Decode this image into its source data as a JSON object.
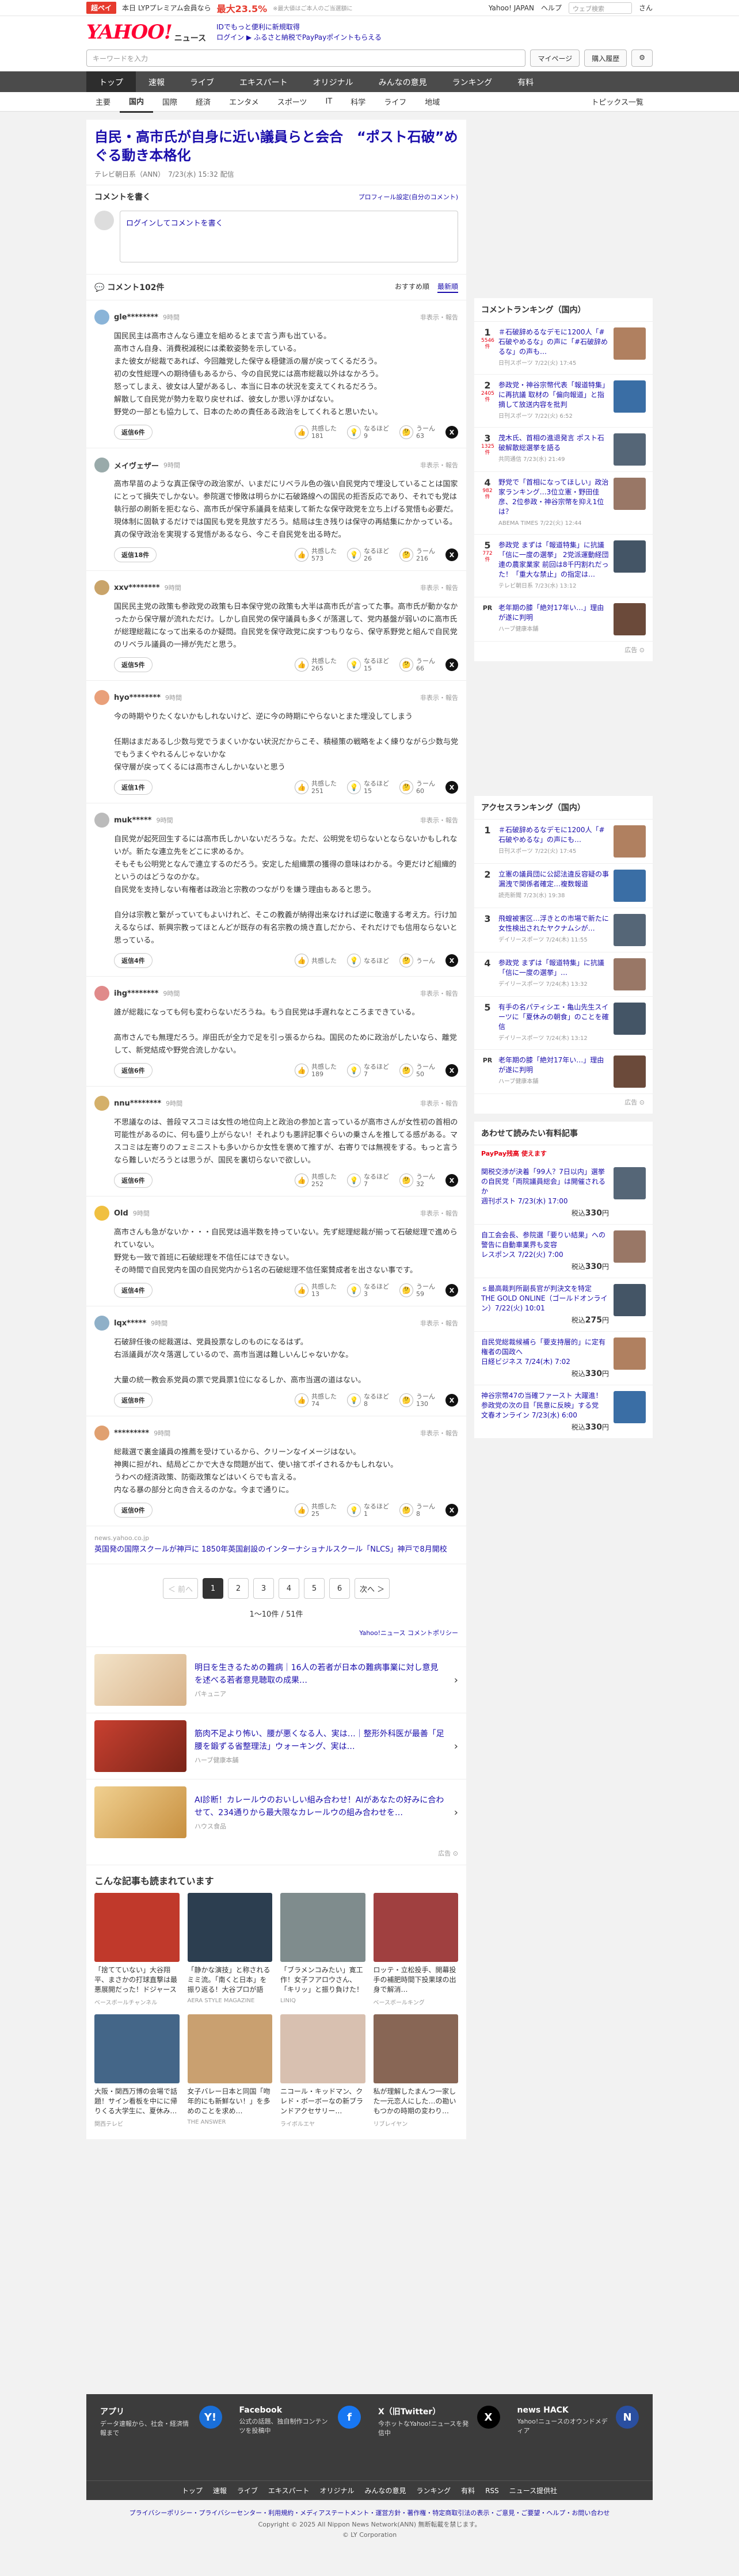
{
  "topbar": {
    "ad_label": "超ペイ",
    "ad_text": "本日 LYPプレミアム会員なら",
    "ad_pct": "最大23.5%",
    "ad_note": "※最大値はご本人のご当選額に",
    "links": [
      "Yahoo! JAPAN",
      "ヘルプ"
    ],
    "search_placeholder": "ウェブ検索",
    "user": "さん"
  },
  "header": {
    "logo": "YAHOO!",
    "logo_sub": "ニュース",
    "msg1": "IDでもっと便利に新規取得",
    "msg2": "ログイン ▶ ふるさと納税でPayPayポイントもらえる"
  },
  "search": {
    "placeholder": "キーワードを入力",
    "btn_mypage": "マイページ",
    "btn_subscribe": "購入履歴"
  },
  "mainnav": [
    "トップ",
    "速報",
    "ライブ",
    "エキスパート",
    "オリジナル",
    "みんなの意見",
    "ランキング",
    "有料"
  ],
  "subnav": [
    "主要",
    "国内",
    "国際",
    "経済",
    "エンタメ",
    "スポーツ",
    "IT",
    "科学",
    "ライフ",
    "地域"
  ],
  "subnav_right": "トピックス一覧",
  "article": {
    "title": "自民・高市氏が自身に近い議員らと会合　“ポスト石破”めぐる動き本格化",
    "meta": "テレビ朝日系（ANN）　7/23(水) 15:32 配信"
  },
  "comment_form": {
    "heading": "コメントを書く",
    "profile_link": "プロフィール設定(自分のコメント)",
    "login_prompt": "ログインしてコメントを書く"
  },
  "comments_header": {
    "count": "コメント102件",
    "sort_recommended": "おすすめ順",
    "sort_newest": "最新順"
  },
  "labels": {
    "nonrep": "非表示・報告",
    "react1": "共感した",
    "react2": "なるほど",
    "react3": "うーん",
    "x": "X"
  },
  "comments": [
    {
      "user": "gle********",
      "ago": "9時間",
      "color": "#8ab4d8",
      "body": "国民民主は高市さんなら連立を組めるとまで言う声も出ている。\n高市さん自身、消費税減税には柔軟姿勢を示している。\nまた彼女が総裁であれば、今回離党した保守＆穏健派の層が戻ってくるだろう。\n初の女性総理への期待値もあるから、今の自民党には高市総裁以外はなかろう。\n怒ってしまえ、彼女は人望があるし、本当に日本の状況を変えてくれるだろう。\n解散して自民党が勢力を取り戻せれば、彼女しか思い浮かばない。\n野党の一部とも協力して、日本のための責任ある政治をしてくれると思いたい。",
      "reply": "返信6件",
      "r1": "181",
      "r2": "9",
      "r3": "63"
    },
    {
      "user": "メイヴェザー",
      "ago": "9時間",
      "color": "#9aa",
      "body": "高市早苗のような真正保守の政治家が、いまだにリベラル色の強い自民党内で埋没していることは国家にとって損失でしかない。参院選で惨敗は明らかに石破路線への国民の拒否反応であり、それでも党は執行部の刷新を拒むなら、高市氏が保守系議員を結束して新たな保守政党を立ち上げる覚悟も必要だ。現体制に固執するだけでは国民も党を見放すだろう。結局は生き残りは保守の再結集にかかっている。真の保守政治を実現する覚悟があるなら、今こそ自民党を出る時だ。",
      "reply": "返信18件",
      "r1": "573",
      "r2": "26",
      "r3": "216"
    },
    {
      "user": "xxv********",
      "ago": "9時間",
      "color": "#c9a46a",
      "body": "国民民主党の政策も参政党の政策も日本保守党の政策も大半は高市氏が言ってた事。高市氏が動かなかったから保守層が流れただけ。しかし自民党の保守議員も多くが落選して、党内基盤が弱いのに高市氏が総理総裁になって出来るのか疑問。自民党を保守政党に戻すつもりなら、保守系野党と組んで自民党のリベラル議員の一掃が先だと思う。",
      "reply": "返信5件",
      "r1": "265",
      "r2": "15",
      "r3": "66"
    },
    {
      "user": "hyo********",
      "ago": "9時間",
      "color": "#e9a07a",
      "body": "今の時期やりたくないかもしれないけど、逆に今の時期にやらないとまた埋没してしまう\n\n任期はまだあるし少数与党でうまくいかない状況だからこそ、積極策の戦略をよく練りながら少数与党でもうまくやれるんじゃないかな\n保守層が戻ってくるには高市さんしかいないと思う",
      "reply": "返信1件",
      "r1": "251",
      "r2": "15",
      "r3": "60"
    },
    {
      "user": "muk*****",
      "ago": "9時間",
      "color": "#bbb",
      "body": "自民党が起死回生するには高市氏しかいないだろうな。ただ、公明党を切らないとならないかもしれないが。新たな連立先をどこに求めるか。\nそもそも公明党となんで連立するのだろう。安定した組織票の獲得の意味はわかる。今更だけど組織的というのはどうなのかな。\n自民党を支持しない有権者は政治と宗教のつながりを嫌う理由もあると思う。\n\n自分は宗教と繋がっていてもよいけれど、そこの教義が納得出来なければ逆に敬遠する考え方。行け加えるならば、新興宗教ってほとんどが既存の有名宗教の焼き直しだから、それだけでも信用ならないと思っている。",
      "reply": "返信4件",
      "r1": "",
      "r2": "",
      "r3": ""
    },
    {
      "user": "ihg********",
      "ago": "9時間",
      "color": "#e08a8a",
      "body": "誰が総裁になっても何も変わらないだろうね。もう自民党は手遅れなところまできている。\n\n高市さんでも無理だろう。岸田氏が全力で足を引っ張るからね。国民のために政治がしたいなら、離党して、新党結成や野党合流しかない。",
      "reply": "返信6件",
      "r1": "189",
      "r2": "7",
      "r3": "50"
    },
    {
      "user": "nnu********",
      "ago": "9時間",
      "color": "#d4b06a",
      "body": "不思議なのは、普段マスコミは女性の地位向上と政治の参加と言っているが高市さんが女性初の首相の可能性があるのに、何も盛り上がらない！それよりも悪評記事ぐらいの乗さんを推してる感がある。マスコミは左寄りのフェミニストも多いからか女性を褒めて推すが、右寄りでは無視をする。もっと言うなら難しいだろうとは思うが、国民を裏切らないで欲しい。",
      "reply": "返信6件",
      "r1": "252",
      "r2": "7",
      "r3": "32"
    },
    {
      "user": "Old",
      "ago": "9時間",
      "color": "#f0c040",
      "body": "高市さんも急がないか・・・自民党は過半数を持っていない。先ず総理総裁が揃って石破総理で進められていない。\n野党も一致で首班に石破総理を不信任にはできない。\nその時間で自民党内を国の自民党内から1名の石破総理不信任案賛成者を出さない事です。",
      "reply": "返信4件",
      "r1": "13",
      "r2": "3",
      "r3": "59"
    },
    {
      "user": "lqx*****",
      "ago": "9時間",
      "color": "#8fb0c8",
      "body": "石破辞任後の総裁選は、党員投票なしのものになるはず。\n右派議員が次々落選しているので、高市当選は難しいんじゃないかな。\n\n大量の統一教会系党員の票で党員票1位になるしか、高市当選の道はない。",
      "reply": "返信8件",
      "r1": "74",
      "r2": "8",
      "r3": "130"
    },
    {
      "user": "*********",
      "ago": "9時間",
      "color": "#e0a070",
      "body": "総裁選で裏金議員の推薦を受けているから、クリーンなイメージはない。\n神輿に担がれ、結局どこかで大きな問題が出て、使い捨てポイされるかもしれない。\nうわべの経済政策、防衛政策などはいくらでも言える。\n内なる暴の部分と向き合えるのかな。今まで通りに。",
      "reply": "返信0件",
      "r1": "25",
      "r2": "1",
      "r3": "8"
    }
  ],
  "ad_inline": {
    "source": "news.yahoo.co.jp",
    "title": "英国発の国際スクールが神戸に 1850年英国創設のインターナショナルスクール「NLCS」神戸で8月開校"
  },
  "pager": {
    "prev": "＜ 前へ",
    "pages": [
      "1",
      "2",
      "3",
      "4",
      "5",
      "6"
    ],
    "next": "次へ ＞",
    "info": "1〜10件 / 51件",
    "policy": "Yahoo!ニュース コメントポリシー"
  },
  "promos": [
    {
      "title": "明日を生きるための難病｜16人の若者が日本の難病事業に対し意見を述べる若者意見聴取の成果…",
      "source": "パキュニア"
    },
    {
      "title": "筋肉不足より怖い、腰が悪くなる人、実は…｜整形外科医が最善「足腰を鍛ずる省整理法」ウォーキング、実は…",
      "source": "ハーブ健康本舗"
    },
    {
      "title": "AI診断！カレールウのおいしい組み合わせ！AIがあなたの好みに合わせて、234通りから最大限なカレールウの組み合わせを…",
      "source": "ハウス食品"
    }
  ],
  "ad_note": "広告 ⊙",
  "related": {
    "heading": "こんな記事も読まれています",
    "items": [
      {
        "title": "「捨てていない」大谷翔平、まさかの打球直撃は最悪展開だった！ドジャースが選んだ…",
        "source": "ベースボールチャンネル"
      },
      {
        "title": "「静かな演技」と称されるミミ流。「南くと日本」を振り返る！大谷プロが語る…",
        "source": "AERA STYLE MAGAZINE"
      },
      {
        "title": "「ブラメンコみたい」寛工作！女子フアロウさん、「キリッ」と振り負けた！",
        "source": "LINIQ"
      },
      {
        "title": "ロッテ・立松投手、開幕投手の補肥時間下投果球の出身で解消…",
        "source": "ベースボールキング"
      },
      {
        "title": "大阪・関西万博の会場で話題！サイン看板を中にに帰りくる大学生に、夏休み…",
        "source": "関西テレビ"
      },
      {
        "title": "女子バレー日本と同国「吻年的にも新鮮ない！」を多めのことを求め…",
        "source": "THE ANSWER"
      },
      {
        "title": "ニコール・キッドマン、クレド・ボーボーなの新ブランドアクセサリー…",
        "source": "ライボルエヤ"
      },
      {
        "title": "私が理解したまんつ一家した一元恋人にした…の勘いもつかの時期の変わり…",
        "source": "リブレイヤン"
      }
    ]
  },
  "ranking_comment": {
    "heading": "コメントランキング（国内）",
    "items": [
      {
        "num": "1",
        "cnt": "5546件",
        "title": "＃石破辞めるなデモに1200人「#石破やめるな」の声に「#石破辞めるな」の声も…",
        "source": "日刊スポーツ 7/22(火) 17:45"
      },
      {
        "num": "2",
        "cnt": "2405件",
        "title": "参政党・神谷宗幣代表「報道特集」に再抗議 取材の「偏向報道」と指摘して放送内容を批判",
        "source": "日刊スポーツ 7/22(火) 6:52"
      },
      {
        "num": "3",
        "cnt": "1325件",
        "title": "茂木氏、首相の進退発言 ポスト石破解散総選挙を語る",
        "source": "共同通信 7/23(水) 21:49"
      },
      {
        "num": "4",
        "cnt": "982件",
        "title": "野党で「首相になってほしい」政治家ランキング…3位立憲・野田佳彦、2位参政・神谷宗幣を抑え1位は？",
        "source": "ABEMA TIMES 7/22(火) 12:44"
      },
      {
        "num": "5",
        "cnt": "772件",
        "title": "参政党 まずは「報道特集」に抗議「信に一度の選挙」 2党派運動経団連の農家業家 前回は8千円割れだった！「重大な禁止」の指定は…",
        "source": "テレビ朝日系 7/23(水) 13:12"
      }
    ],
    "pr": {
      "title": "老年期の膝「絶対17年い…」理由が遂に判明",
      "source": "ハーブ健康本舗"
    }
  },
  "ranking_access": {
    "heading": "アクセスランキング（国内）",
    "items": [
      {
        "num": "1",
        "title": "＃石破辞めるなデモに1200人「#石破やめるな」の声にも…",
        "source": "日刊スポーツ 7/22(火) 17:45"
      },
      {
        "num": "2",
        "title": "立憲の議員団に公認法違反容疑の事 漏洩で関係者確定…複数報道",
        "source": "読売新聞 7/23(水) 19:38"
      },
      {
        "num": "3",
        "title": "飛蝗被害区…浮きとの市場で新たに女性検出されたヤクナムシが…",
        "source": "デイリースポーツ 7/24(木) 11:55"
      },
      {
        "num": "4",
        "title": "参政党 まずは「報道特集」に抗議「信に一度の選挙」…",
        "source": "デイリースポーツ 7/24(木) 13:32"
      },
      {
        "num": "5",
        "title": "有手の名パティシエ・亀山先生スイーツに「夏休みの朝食」のことを確信",
        "source": "デイリースポーツ 7/24(木) 13:12"
      }
    ],
    "pr": {
      "title": "老年期の膝「絶対17年い…」理由が遂に判明",
      "source": "ハーブ健康本舗"
    }
  },
  "paid_ranking": {
    "heading": "あわせて読みたい有料記事",
    "sub": "PayPay残高 使えます",
    "items": [
      {
        "title": "関税交渉が決着「99人？7日以内」選挙の自民党「両院議員総会」は開催されるか",
        "source": "週刊ポスト 7/23(水) 17:00",
        "price": "330"
      },
      {
        "title": "自工会会長、参院選「要りい結果」への警告に自動車業界も変容",
        "source": "レスポンス 7/22(火) 7:00",
        "price": "330"
      },
      {
        "title": "ｓ最高裁判所副長官が判決文を特定",
        "source": "THE GOLD ONLINE（ゴールドオンライン）7/22(火) 10:01",
        "price": "275"
      },
      {
        "title": "自民党総裁候補ら「要支持層的」に定有権者の国政へ",
        "source": "日経ビジネス 7/24(木) 7:02",
        "price": "330"
      },
      {
        "title": "神谷宗幣47の当確ファースト 大躍進！ 参政党の次の目「民意に反映」する党",
        "source": "文春オンライン 7/23(水) 6:00",
        "price": "330"
      }
    ]
  },
  "footer": {
    "cols": [
      {
        "t": "アプリ",
        "d": "データ速報から、社会・経済情報まで",
        "icon": "Y!"
      },
      {
        "t": "Facebook",
        "d": "公式の話題、独自制作コンテンツを投稿中",
        "icon": "f"
      },
      {
        "t": "X（旧Twitter）",
        "d": "今ホットなYahoo!ニュースを発信中",
        "icon": "X"
      },
      {
        "t": "news HACK",
        "d": "Yahoo!ニュースのオウンドメディア",
        "icon": "N"
      }
    ],
    "nav": [
      "トップ",
      "速報",
      "ライブ",
      "エキスパート",
      "オリジナル",
      "みんなの意見",
      "ランキング",
      "有料",
      "RSS",
      "ニュース提供社"
    ],
    "links": "プライバシーポリシー・プライバシーセンター・利用規約・メディアステートメント・運営方針・著作権・特定商取引法の表示・ご意見・ご要望・ヘルプ・お問い合わせ",
    "copy1": "Copyright © 2025 All Nippon News Network(ANN) 無断転載を禁じます。",
    "copy2": "© LY Corporation"
  }
}
